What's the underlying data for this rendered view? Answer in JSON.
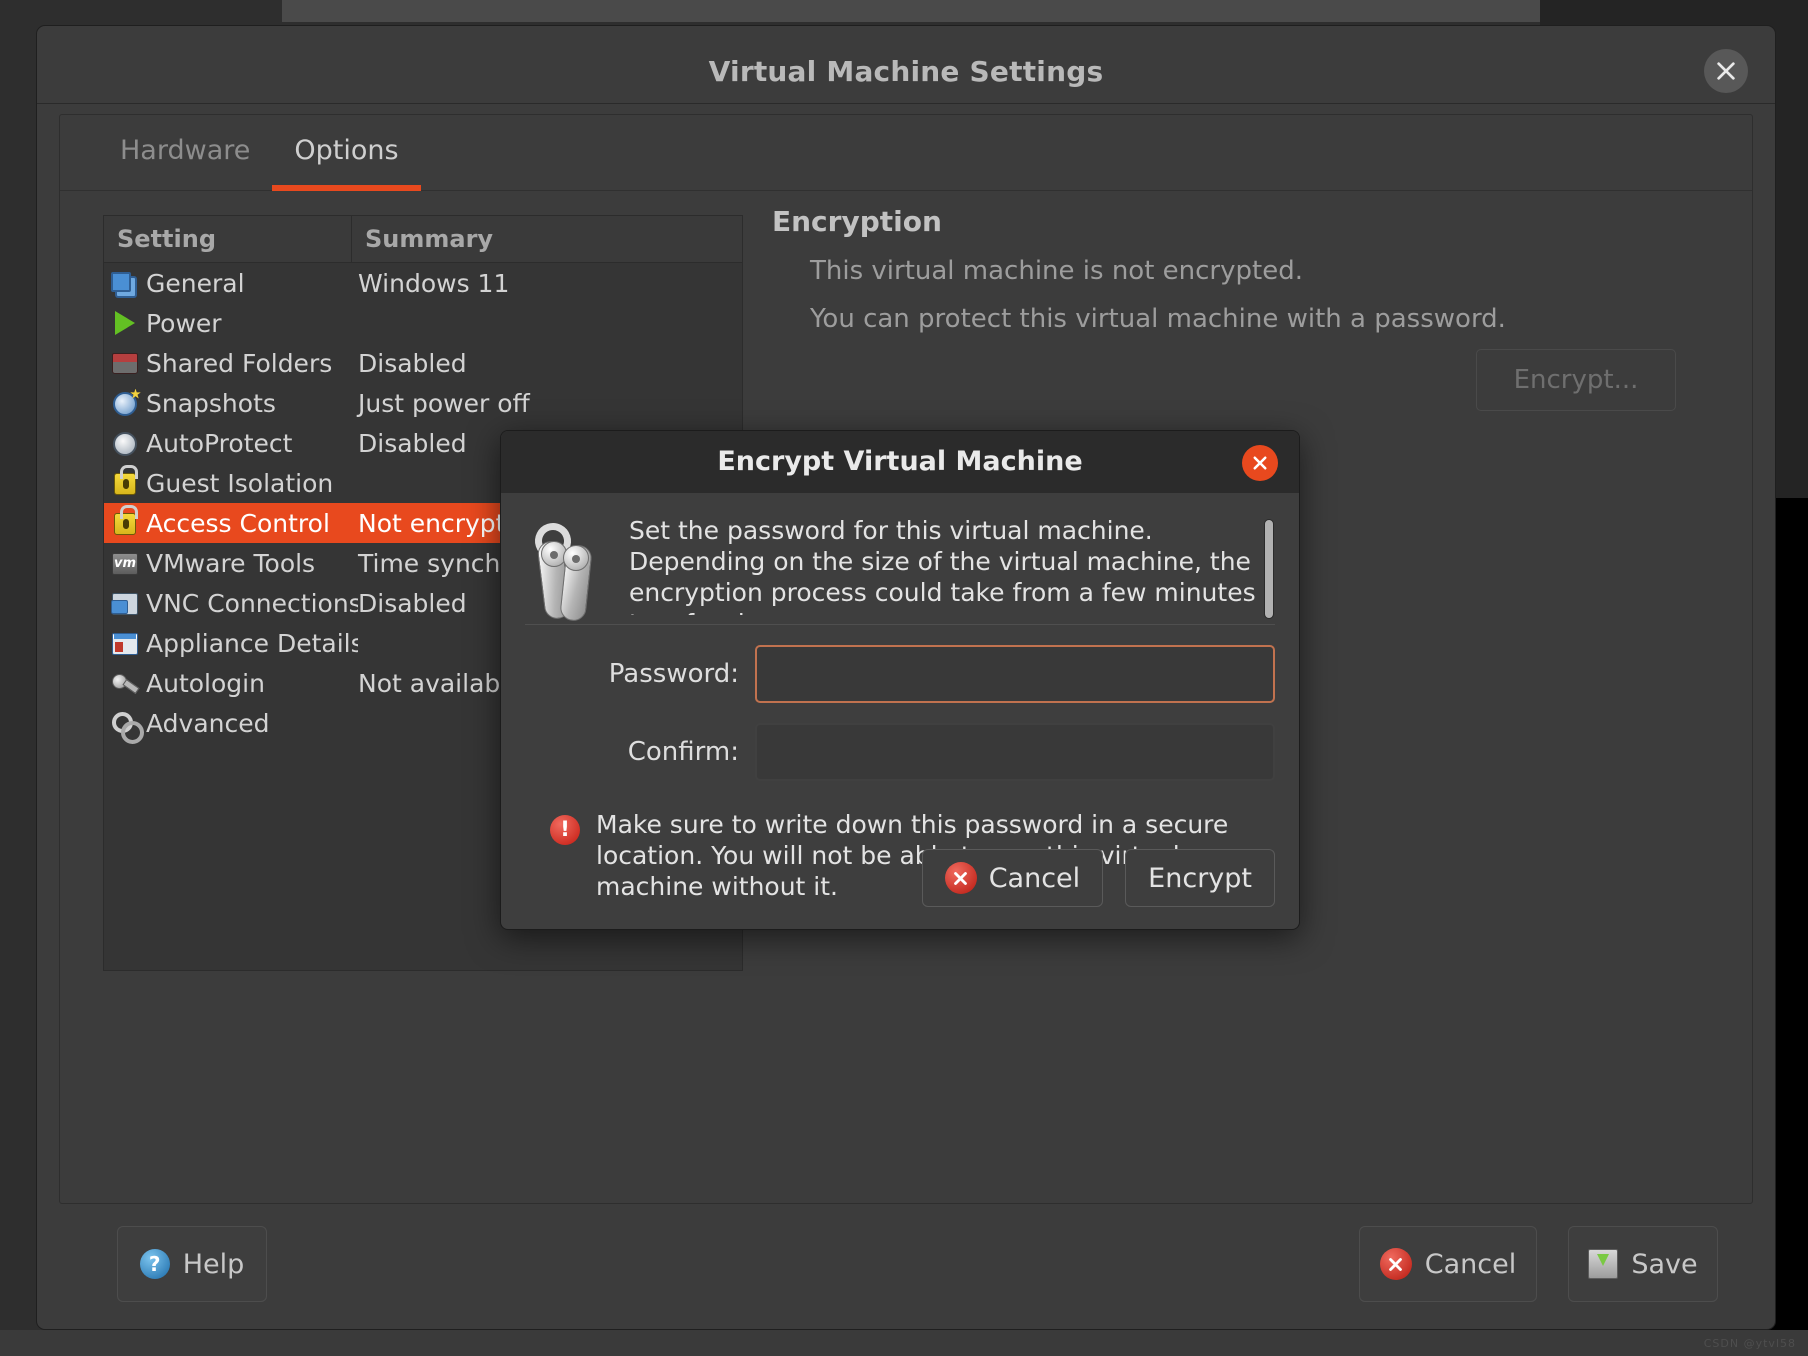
{
  "window": {
    "title": "Virtual Machine Settings",
    "close_icon": "close-icon"
  },
  "tabs": [
    {
      "label": "Hardware",
      "active": false
    },
    {
      "label": "Options",
      "active": true
    }
  ],
  "settings_list": {
    "columns": [
      "Setting",
      "Summary"
    ],
    "rows": [
      {
        "icon": "general-icon",
        "label": "General",
        "summary": "Windows 11",
        "selected": false
      },
      {
        "icon": "power-icon",
        "label": "Power",
        "summary": "",
        "selected": false
      },
      {
        "icon": "shared-folders-icon",
        "label": "Shared Folders",
        "summary": "Disabled",
        "selected": false
      },
      {
        "icon": "snapshots-icon",
        "label": "Snapshots",
        "summary": "Just power off",
        "selected": false
      },
      {
        "icon": "autoprotect-icon",
        "label": "AutoProtect",
        "summary": "Disabled",
        "selected": false
      },
      {
        "icon": "guest-isolation-icon",
        "label": "Guest Isolation",
        "summary": "",
        "selected": false
      },
      {
        "icon": "access-control-icon",
        "label": "Access Control",
        "summary": "Not encrypted",
        "selected": true
      },
      {
        "icon": "vmware-tools-icon",
        "label": "VMware Tools",
        "summary": "Time synchro",
        "selected": false
      },
      {
        "icon": "vnc-connections-icon",
        "label": "VNC Connections",
        "summary": "Disabled",
        "selected": false
      },
      {
        "icon": "appliance-details-icon",
        "label": "Appliance Details",
        "summary": "",
        "selected": false
      },
      {
        "icon": "autologin-icon",
        "label": "Autologin",
        "summary": "Not available",
        "selected": false
      },
      {
        "icon": "advanced-icon",
        "label": "Advanced",
        "summary": "",
        "selected": false
      }
    ]
  },
  "detail": {
    "title": "Encryption",
    "line1": "This virtual machine is not encrypted.",
    "line2": "You can protect this virtual machine with a password.",
    "encrypt_button": "Encrypt..."
  },
  "footer": {
    "help": "Help",
    "cancel": "Cancel",
    "save": "Save"
  },
  "dialog": {
    "title": "Encrypt Virtual Machine",
    "close_icon": "close-icon",
    "key_icon": "keys-icon",
    "intro": "Set the password for this virtual machine. Depending on the size of the virtual machine, the encryption process could take from a few minutes to a few hours.",
    "password_label": "Password:",
    "password_value": "",
    "confirm_label": "Confirm:",
    "confirm_value": "",
    "warning_icon": "!",
    "warning": "Make sure to write down this password in a secure location. You will not be able to use this virtual machine without it.",
    "cancel_button": "Cancel",
    "encrypt_button": "Encrypt"
  },
  "watermark": "CSDN @ytvl58",
  "colors": {
    "accent": "#e8491e",
    "window_bg": "#3c3c3c",
    "list_bg": "#353535",
    "dialog_bg": "#3e3e3e",
    "text": "#d3d3d3",
    "focus_border": "#c1724f"
  }
}
